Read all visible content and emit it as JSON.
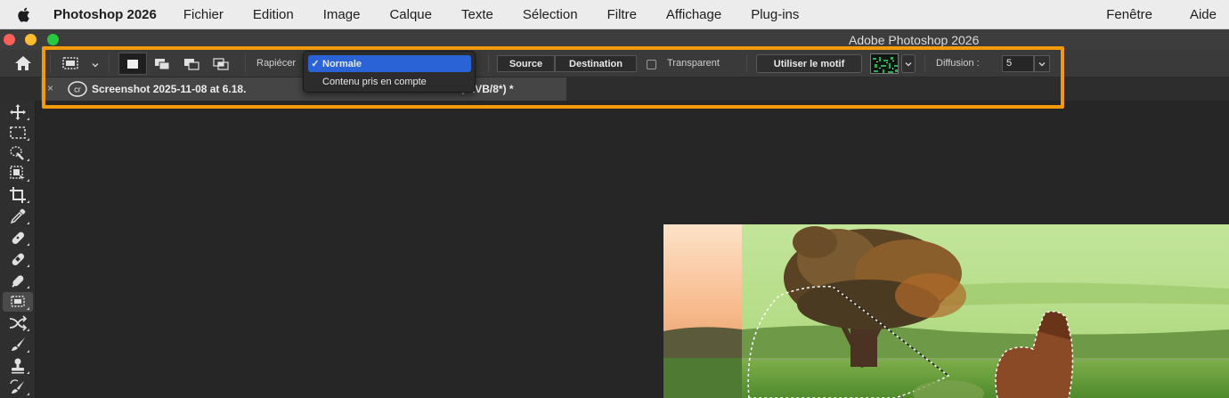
{
  "menubar": {
    "app_name": "Photoshop 2026",
    "items": [
      "Fichier",
      "Edition",
      "Image",
      "Calque",
      "Texte",
      "Sélection",
      "Filtre",
      "Affichage",
      "Plug-ins"
    ],
    "right_items": [
      "Fenêtre",
      "Aide"
    ]
  },
  "window": {
    "title": "Adobe Photoshop 2026"
  },
  "options": {
    "patch_label": "Rapiécer",
    "patch_dropdown": {
      "selected": "Normale",
      "options": [
        "Normale",
        "Contenu pris en compte"
      ]
    },
    "source_label": "Source",
    "destination_label": "Destination",
    "transparent_label": "Transparent",
    "use_pattern_label": "Utiliser le motif",
    "diffusion_label": "Diffusion :",
    "diffusion_value": "5"
  },
  "document": {
    "tab_title_left": "Screenshot 2025-11-08 at 6.18.",
    "tab_title_right": "1, RVB/8*) *",
    "tab_close": "×"
  },
  "collapse_glyph": "»",
  "tools": [
    "move-tool",
    "marquee-tool",
    "quick-selection-tool",
    "object-selection-tool",
    "crop-tool",
    "eyedropper-tool",
    "spot-healing-tool",
    "healing-brush-tool",
    "remove-tool",
    "patch-tool",
    "content-aware-move-tool",
    "brush-tool",
    "clone-stamp-tool",
    "history-brush-tool"
  ],
  "colors": {
    "highlight": "#f39a0c",
    "dropdown_selected": "#2a63d6",
    "accent_active_tool": "#4a4a4a"
  }
}
